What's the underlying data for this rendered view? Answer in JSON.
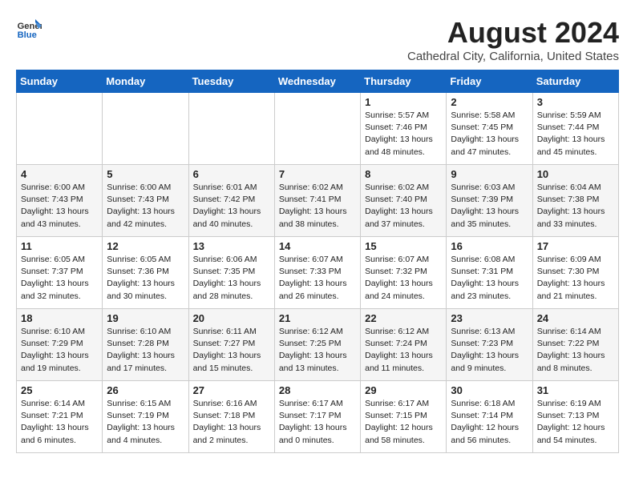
{
  "logo": {
    "line1": "General",
    "line2": "Blue"
  },
  "title": "August 2024",
  "location": "Cathedral City, California, United States",
  "weekdays": [
    "Sunday",
    "Monday",
    "Tuesday",
    "Wednesday",
    "Thursday",
    "Friday",
    "Saturday"
  ],
  "weeks": [
    [
      {
        "day": "",
        "info": ""
      },
      {
        "day": "",
        "info": ""
      },
      {
        "day": "",
        "info": ""
      },
      {
        "day": "",
        "info": ""
      },
      {
        "day": "1",
        "info": "Sunrise: 5:57 AM\nSunset: 7:46 PM\nDaylight: 13 hours\nand 48 minutes."
      },
      {
        "day": "2",
        "info": "Sunrise: 5:58 AM\nSunset: 7:45 PM\nDaylight: 13 hours\nand 47 minutes."
      },
      {
        "day": "3",
        "info": "Sunrise: 5:59 AM\nSunset: 7:44 PM\nDaylight: 13 hours\nand 45 minutes."
      }
    ],
    [
      {
        "day": "4",
        "info": "Sunrise: 6:00 AM\nSunset: 7:43 PM\nDaylight: 13 hours\nand 43 minutes."
      },
      {
        "day": "5",
        "info": "Sunrise: 6:00 AM\nSunset: 7:43 PM\nDaylight: 13 hours\nand 42 minutes."
      },
      {
        "day": "6",
        "info": "Sunrise: 6:01 AM\nSunset: 7:42 PM\nDaylight: 13 hours\nand 40 minutes."
      },
      {
        "day": "7",
        "info": "Sunrise: 6:02 AM\nSunset: 7:41 PM\nDaylight: 13 hours\nand 38 minutes."
      },
      {
        "day": "8",
        "info": "Sunrise: 6:02 AM\nSunset: 7:40 PM\nDaylight: 13 hours\nand 37 minutes."
      },
      {
        "day": "9",
        "info": "Sunrise: 6:03 AM\nSunset: 7:39 PM\nDaylight: 13 hours\nand 35 minutes."
      },
      {
        "day": "10",
        "info": "Sunrise: 6:04 AM\nSunset: 7:38 PM\nDaylight: 13 hours\nand 33 minutes."
      }
    ],
    [
      {
        "day": "11",
        "info": "Sunrise: 6:05 AM\nSunset: 7:37 PM\nDaylight: 13 hours\nand 32 minutes."
      },
      {
        "day": "12",
        "info": "Sunrise: 6:05 AM\nSunset: 7:36 PM\nDaylight: 13 hours\nand 30 minutes."
      },
      {
        "day": "13",
        "info": "Sunrise: 6:06 AM\nSunset: 7:35 PM\nDaylight: 13 hours\nand 28 minutes."
      },
      {
        "day": "14",
        "info": "Sunrise: 6:07 AM\nSunset: 7:33 PM\nDaylight: 13 hours\nand 26 minutes."
      },
      {
        "day": "15",
        "info": "Sunrise: 6:07 AM\nSunset: 7:32 PM\nDaylight: 13 hours\nand 24 minutes."
      },
      {
        "day": "16",
        "info": "Sunrise: 6:08 AM\nSunset: 7:31 PM\nDaylight: 13 hours\nand 23 minutes."
      },
      {
        "day": "17",
        "info": "Sunrise: 6:09 AM\nSunset: 7:30 PM\nDaylight: 13 hours\nand 21 minutes."
      }
    ],
    [
      {
        "day": "18",
        "info": "Sunrise: 6:10 AM\nSunset: 7:29 PM\nDaylight: 13 hours\nand 19 minutes."
      },
      {
        "day": "19",
        "info": "Sunrise: 6:10 AM\nSunset: 7:28 PM\nDaylight: 13 hours\nand 17 minutes."
      },
      {
        "day": "20",
        "info": "Sunrise: 6:11 AM\nSunset: 7:27 PM\nDaylight: 13 hours\nand 15 minutes."
      },
      {
        "day": "21",
        "info": "Sunrise: 6:12 AM\nSunset: 7:25 PM\nDaylight: 13 hours\nand 13 minutes."
      },
      {
        "day": "22",
        "info": "Sunrise: 6:12 AM\nSunset: 7:24 PM\nDaylight: 13 hours\nand 11 minutes."
      },
      {
        "day": "23",
        "info": "Sunrise: 6:13 AM\nSunset: 7:23 PM\nDaylight: 13 hours\nand 9 minutes."
      },
      {
        "day": "24",
        "info": "Sunrise: 6:14 AM\nSunset: 7:22 PM\nDaylight: 13 hours\nand 8 minutes."
      }
    ],
    [
      {
        "day": "25",
        "info": "Sunrise: 6:14 AM\nSunset: 7:21 PM\nDaylight: 13 hours\nand 6 minutes."
      },
      {
        "day": "26",
        "info": "Sunrise: 6:15 AM\nSunset: 7:19 PM\nDaylight: 13 hours\nand 4 minutes."
      },
      {
        "day": "27",
        "info": "Sunrise: 6:16 AM\nSunset: 7:18 PM\nDaylight: 13 hours\nand 2 minutes."
      },
      {
        "day": "28",
        "info": "Sunrise: 6:17 AM\nSunset: 7:17 PM\nDaylight: 13 hours\nand 0 minutes."
      },
      {
        "day": "29",
        "info": "Sunrise: 6:17 AM\nSunset: 7:15 PM\nDaylight: 12 hours\nand 58 minutes."
      },
      {
        "day": "30",
        "info": "Sunrise: 6:18 AM\nSunset: 7:14 PM\nDaylight: 12 hours\nand 56 minutes."
      },
      {
        "day": "31",
        "info": "Sunrise: 6:19 AM\nSunset: 7:13 PM\nDaylight: 12 hours\nand 54 minutes."
      }
    ]
  ]
}
